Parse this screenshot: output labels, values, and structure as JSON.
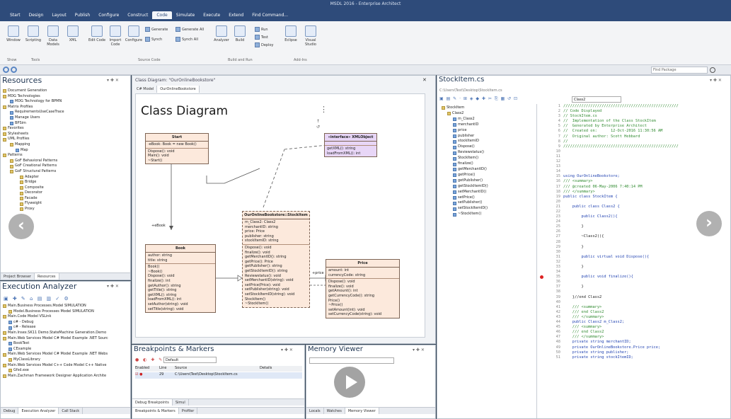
{
  "window": {
    "title": "MSDL 2016 - Enterprise Architect"
  },
  "menu": [
    "Start",
    "Design",
    "Layout",
    "Publish",
    "Configure",
    "Construct",
    "Code",
    "Simulate",
    "Execute",
    "Extend",
    "Find Command..."
  ],
  "ribbon": {
    "buttons": [
      "Window",
      "Scripting",
      "Data Models",
      "XML",
      "Edit Code",
      "Import Code",
      "Configure",
      "Analyzer",
      "Build",
      "Eclipse",
      "Visual Studio"
    ],
    "small": [
      "Generate",
      "Synch",
      "Generate All",
      "Synch All",
      "Run",
      "Test",
      "Deploy"
    ],
    "groups": [
      "Show",
      "Tools",
      "Source Code",
      "Build and Run",
      "Add-Ins"
    ]
  },
  "find_package": "Find Package",
  "resources": {
    "title": "Resources",
    "tree": [
      "Document Generation",
      "MDG Technologies",
      "MDG Technology for BPMN",
      "Matrix Profiles",
      "RequirementsUseCaseTrace",
      "Manage Users",
      "BPSim",
      "Favorites",
      "Stylesheets",
      "UML Profiles",
      "Mapping",
      "Map",
      "Patterns",
      "GoF Behavioral Patterns",
      "GoF Creational Patterns",
      "GoF Structural Patterns",
      "Adapter",
      "Bridge",
      "Composite",
      "Decorator",
      "Facade",
      "Flyweight",
      "Proxy"
    ],
    "tabs": [
      "Project Browser",
      "Resources"
    ]
  },
  "exec": {
    "title": "Execution Analyzer",
    "tree": [
      "Main.Business Processes.Model SIMULATION",
      "Model.Business Processes Model SIMULATION",
      "Main.Code Model VSLink",
      "c# - Debug",
      "c# - Release",
      "Main.Insex.SK11 Demo.StateMachine Generation.Demo",
      "Main.Web Services Model C# Model Example .NET Sourc",
      "BookTest",
      "CExample",
      "Main.Web Services Model C# Model Example .NET Webs",
      "MyClassLibrary",
      "Main.Web Services Model C++ Code Model C++ Native",
      "Gfsd.exe",
      "Main.Zachman Framework Designer Application Archite"
    ],
    "tabs": [
      "Debug",
      "Execution Analyzer",
      "Call Stack"
    ]
  },
  "diagram": {
    "tabs": [
      "C# Model",
      "OurOnlineBookstore"
    ],
    "header": "Class Diagram: \"OurOnlineBookstore\"",
    "title": "Class Diagram",
    "classes": [
      {
        "name": "Start",
        "attrs": [
          "-eBook: Book = new Book()"
        ],
        "ops": [
          "Dispose(): void",
          "Main(): void",
          "~Start()"
        ]
      },
      {
        "name": "«interface» XMLObject",
        "attrs": [],
        "ops": [
          "getXML(): string",
          "loadFromXML(): int"
        ]
      },
      {
        "name": "Book",
        "attrs": [
          "author: string",
          "title: string"
        ],
        "ops": [
          "Book()",
          "~Book()",
          "Dispose(): void",
          "finalize(): int",
          "getAuthor(): string",
          "getTitle(): string",
          "getXML(): string",
          "loadFromXML(): int",
          "setAuthor(string): void",
          "setTitle(string): void"
        ]
      },
      {
        "name": "OurOnlineBookstore::StockItem",
        "attrs": [
          "m_Class2: Class2",
          "merchantID: string",
          "price: Price",
          "publisher: string",
          "stockItemID: string"
        ],
        "ops": [
          "Dispose(): void",
          "finalize(): void",
          "getMerchantID(): string",
          "getPrice(): Price",
          "getPublisher(): string",
          "getStockItemID(): string",
          "Reviewstatus(): void",
          "setMerchantID(string): void",
          "setPrice(Price): void",
          "setPublisher(string): void",
          "setStockItemID(string): void",
          "StockItem()",
          "~StockItem()"
        ]
      },
      {
        "name": "Price",
        "attrs": [
          "amount: int",
          "currencyCode: string"
        ],
        "ops": [
          "Dispose(): void",
          "finalize(): void",
          "getAmount(): int",
          "getCurrencyCode(): string",
          "Price()",
          "~Price()",
          "setAmount(int): void",
          "setCurrencyCode(string): void"
        ]
      }
    ],
    "labels": [
      "+eBook",
      "+price"
    ]
  },
  "breakpoints": {
    "title": "Breakpoints & Markers",
    "filter": "Default",
    "cols": [
      "Enabled",
      "Line",
      "Source",
      "Details"
    ],
    "row": {
      "line": "29",
      "source": "C:\\Users\\Test\\Desktop\\StockItem.cs"
    },
    "tabs": [
      "Debug Breakpoints",
      "Simul"
    ],
    "bottom_tabs": [
      "Breakpoints & Markers",
      "Profiler"
    ]
  },
  "memory": {
    "title": "Memory Viewer",
    "tabs": [
      "Locals",
      "Watches",
      "Memory Viewer"
    ]
  },
  "code_window": {
    "title": "StockItem.cs",
    "path": "C:\\Users\\Test\\Desktop\\StockItem.cs",
    "combo": "Class2",
    "tree": [
      "StockItem",
      "Class2",
      "m_Class2",
      "merchantID",
      "price",
      "publisher",
      "stockItemID",
      "Dispose()",
      "Reviewstatus()",
      "StockItem()",
      "finalize()",
      "getMerchantID()",
      "getPrice()",
      "getPublisher()",
      "getStockItemID()",
      "setMerchantID()",
      "setPrice()",
      "setPublisher()",
      "setStockItemID()",
      "~StockItem()"
    ],
    "lines": [
      "///////////////////////////////////////////////////",
      "// Code Displayed",
      "// StockItem.cs",
      "//  Implementation of the Class StockItem",
      "//  Generated by Enterprise Architect",
      "//  Created on:      12-Oct-2016 11:30:56 AM",
      "//  Original author: Scott Hebbard",
      "//",
      "///////////////////////////////////////////////////",
      "",
      "",
      "",
      "",
      "",
      "using OurOnlineBookstore;",
      "/// <summary>",
      "/// @created 06-May-2006 7:40:14 PM",
      "/// </summary>",
      "public class StockItem {",
      "",
      "    public class Class2 {",
      "",
      "        public Class2(){",
      "",
      "        }",
      "",
      "        ~Class2(){",
      "",
      "        }",
      "",
      "        public virtual void Dispose(){",
      "",
      "        }",
      "",
      "        public void finalize(){",
      "",
      "        }",
      "",
      "    }//end Class2",
      "",
      "    /// <summary>",
      "    /// end Class2",
      "    /// </summary>",
      "    public Class2 m_Class2;",
      "    /// <summary>",
      "    /// end Class2",
      "    /// </summary>",
      "    private string merchantID;",
      "    private OurOnlineBookstore.Price price;",
      "    private string publisher;",
      "    private string stockItemID;"
    ]
  },
  "colors": {
    "menu": "#2e4b7a",
    "class_fill": "#fce9dc",
    "interface_fill": "#e8d6f7",
    "code_comment": "#2f8a2f",
    "code_keyword": "#1d3fb0"
  }
}
